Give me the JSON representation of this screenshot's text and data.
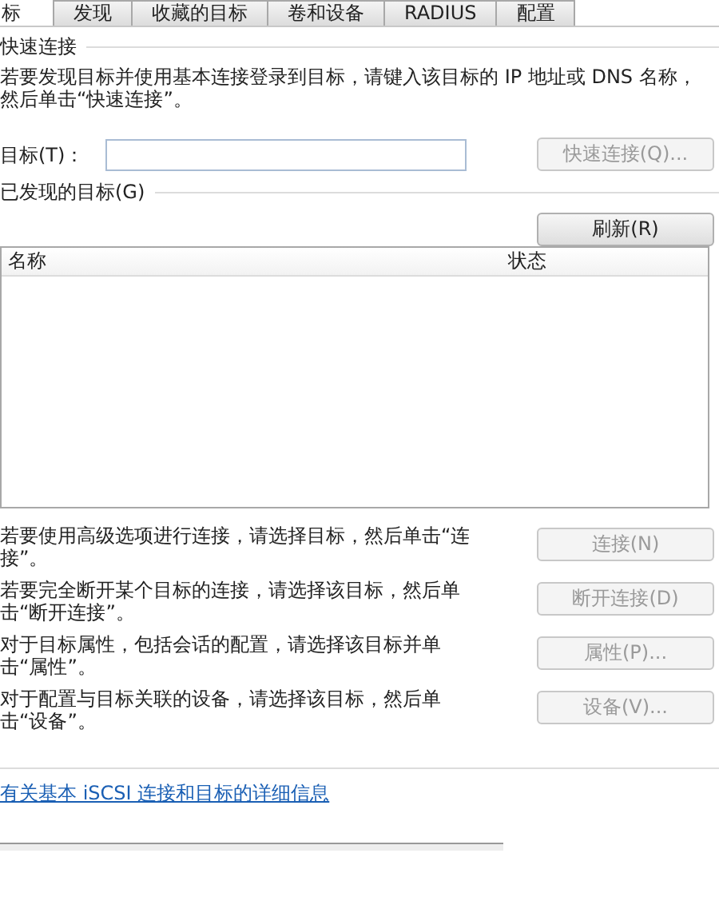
{
  "tabs": [
    {
      "label": "标",
      "selected": true
    },
    {
      "label": "发现",
      "selected": false
    },
    {
      "label": "收藏的目标",
      "selected": false
    },
    {
      "label": "卷和设备",
      "selected": false
    },
    {
      "label": "RADIUS",
      "selected": false
    },
    {
      "label": "配置",
      "selected": false
    }
  ],
  "quick_connect": {
    "title": "快速连接",
    "description": "若要发现目标并使用基本连接登录到目标，请键入该目标的 IP 地址或 DNS 名称，然后单击“快速连接”。",
    "target_label": "目标(T)：",
    "button": {
      "label": "快速连接(Q)...",
      "disabled": true
    }
  },
  "discovered": {
    "title": "已发现的目标(G)",
    "refresh": {
      "label": "刷新(R)",
      "disabled": false
    },
    "columns": [
      "名称",
      "状态"
    ]
  },
  "actions": [
    {
      "text": "若要使用高级选项进行连接，请选择目标，然后单击“连接”。",
      "button": "连接(N)",
      "disabled": true
    },
    {
      "text": "若要完全断开某个目标的连接，请选择该目标，然后单击“断开连接”。",
      "button": "断开连接(D)",
      "disabled": true
    },
    {
      "text": "对于目标属性，包括会话的配置，请选择该目标并单击“属性”。",
      "button": "属性(P)...",
      "disabled": true
    },
    {
      "text": "对于配置与目标关联的设备，请选择该目标，然后单击“设备”。",
      "button": "设备(V)...",
      "disabled": true
    }
  ],
  "help_link": "有关基本 iSCSI 连接和目标的详细信息"
}
